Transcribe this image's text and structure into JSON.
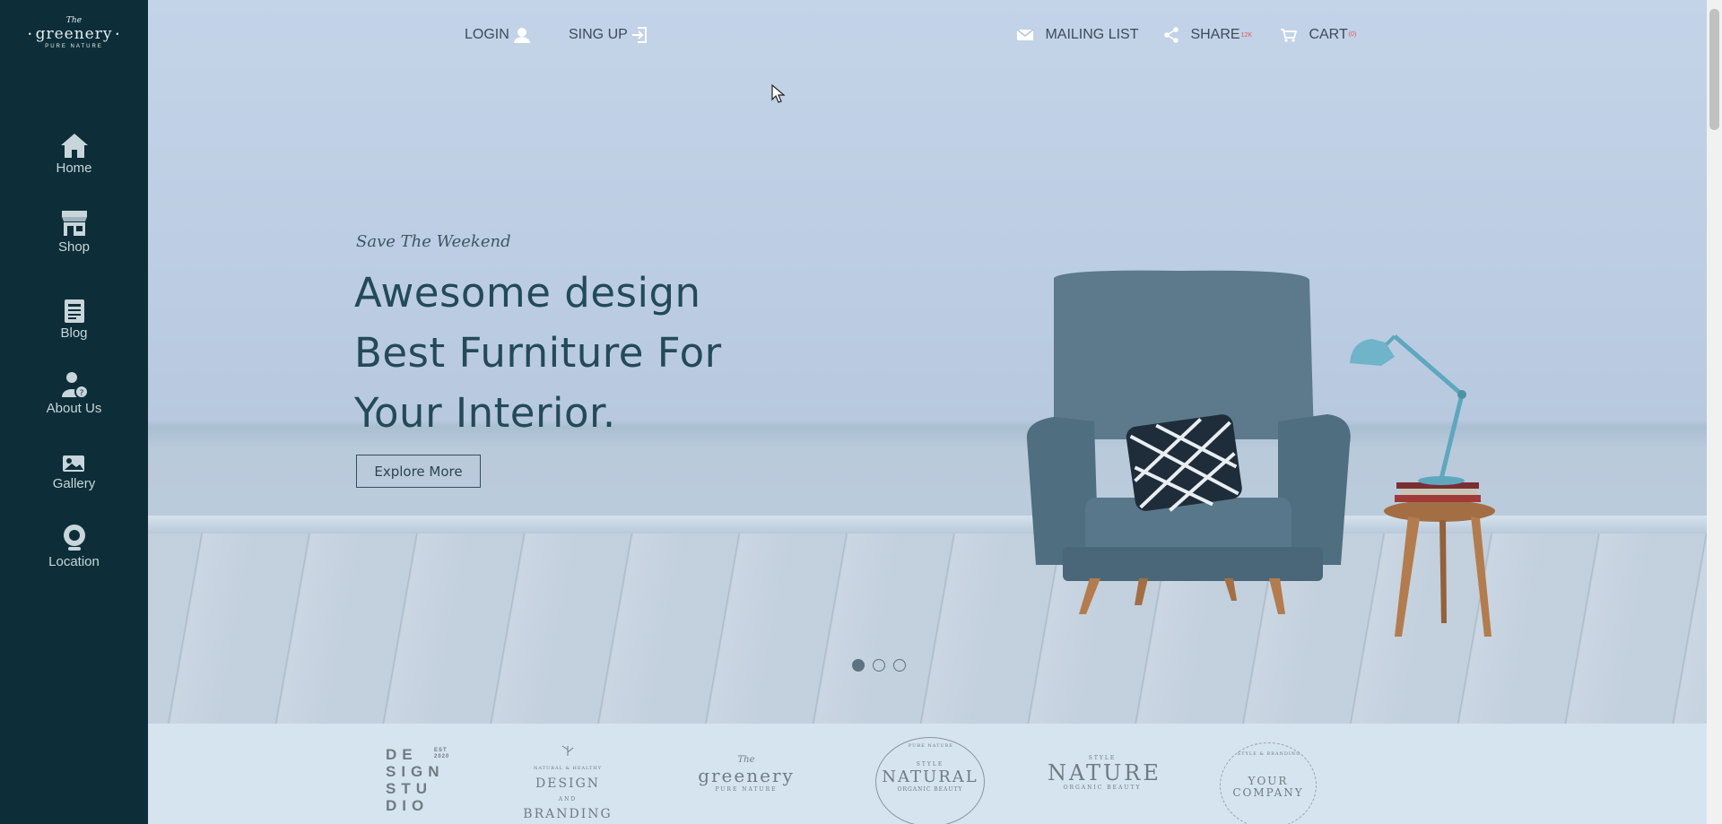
{
  "sidebar": {
    "logo": {
      "the": "The",
      "name": "greenery",
      "tagline": "PURE NATURE"
    },
    "items": [
      {
        "label": "Home",
        "icon": "home-icon"
      },
      {
        "label": "Shop",
        "icon": "shop-icon"
      },
      {
        "label": "Blog",
        "icon": "blog-icon"
      },
      {
        "label": "About Us",
        "icon": "about-icon"
      },
      {
        "label": "Gallery",
        "icon": "gallery-icon"
      },
      {
        "label": "Location",
        "icon": "location-icon"
      }
    ]
  },
  "topbar": {
    "login": "LOGIN",
    "signup": "SING UP",
    "mailing": "MAILING LIST",
    "share": "SHARE",
    "share_badge": "12K",
    "cart": "CART",
    "cart_badge": "(0)"
  },
  "hero": {
    "kicker": "Save The Weekend",
    "headline_lines": [
      "Awesome design",
      "Best Furniture For",
      "Your Interior."
    ],
    "cta": "Explore More",
    "slides": 3,
    "active_slide": 1
  },
  "brands": [
    {
      "name": "DESIGN STUDIO",
      "lines": [
        "DE",
        "SIGN",
        "STU",
        "DIO"
      ],
      "extra": "EST 2020"
    },
    {
      "name": "DESIGN AND BRANDING",
      "lines": [
        "DESIGN",
        "AND",
        "BRANDING"
      ],
      "extra": "NATURAL & HEALTHY"
    },
    {
      "name": "The greenery",
      "lines": [
        "The",
        "greenery",
        "PURE NATURE"
      ]
    },
    {
      "name": "NATURAL",
      "lines": [
        "STYLE",
        "NATURAL",
        "ORGANIC BEAUTY"
      ],
      "extra": "PURE NATURE"
    },
    {
      "name": "NATURE",
      "lines": [
        "STYLE",
        "NATURE",
        "ORGANIC BEAUTY"
      ]
    },
    {
      "name": "YOUR COMPANY",
      "lines": [
        "YOUR",
        "COMPANY"
      ],
      "extra": "STYLE & BRANDING"
    }
  ],
  "colors": {
    "sidebar": "#0d2e38",
    "headline": "#234a58",
    "hero_bg": "#c3d3e8",
    "badge": "#e05555"
  }
}
